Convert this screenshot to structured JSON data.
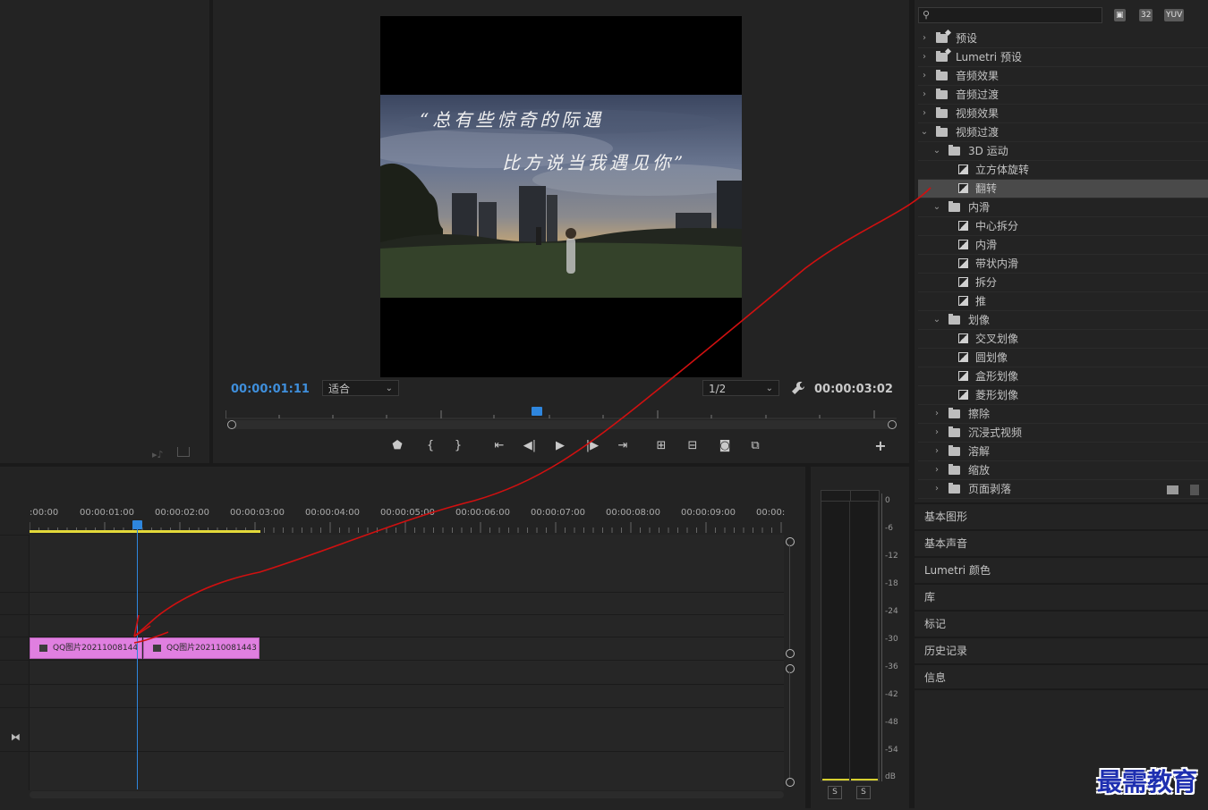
{
  "program_monitor": {
    "current_timecode": "00:00:01:11",
    "duration_timecode": "00:00:03:02",
    "zoom_value": "适合",
    "resolution_value": "1/2",
    "caption_line_1": "“总有些惊奇的际遇",
    "caption_line_2": "比方说当我遇见你”",
    "playhead_fraction": 0.46
  },
  "effects_panel": {
    "search_value": "",
    "badges": [
      "32",
      "YUV"
    ],
    "tree": [
      {
        "label": "预设",
        "type": "preset-folder",
        "level": 0,
        "expanded": false
      },
      {
        "label": "Lumetri 预设",
        "type": "preset-folder",
        "level": 0,
        "expanded": false
      },
      {
        "label": "音频效果",
        "type": "folder",
        "level": 0,
        "expanded": false
      },
      {
        "label": "音频过渡",
        "type": "folder",
        "level": 0,
        "expanded": false
      },
      {
        "label": "视频效果",
        "type": "folder",
        "level": 0,
        "expanded": false
      },
      {
        "label": "视频过渡",
        "type": "folder",
        "level": 0,
        "expanded": true
      },
      {
        "label": "3D 运动",
        "type": "folder",
        "level": 1,
        "expanded": true
      },
      {
        "label": "立方体旋转",
        "type": "effect",
        "level": 2
      },
      {
        "label": "翻转",
        "type": "effect",
        "level": 2,
        "selected": true
      },
      {
        "label": "内滑",
        "type": "folder",
        "level": 1,
        "expanded": true
      },
      {
        "label": "中心拆分",
        "type": "effect",
        "level": 2
      },
      {
        "label": "内滑",
        "type": "effect",
        "level": 2
      },
      {
        "label": "带状内滑",
        "type": "effect",
        "level": 2
      },
      {
        "label": "拆分",
        "type": "effect",
        "level": 2
      },
      {
        "label": "推",
        "type": "effect",
        "level": 2
      },
      {
        "label": "划像",
        "type": "folder",
        "level": 1,
        "expanded": true
      },
      {
        "label": "交叉划像",
        "type": "effect",
        "level": 2
      },
      {
        "label": "圆划像",
        "type": "effect",
        "level": 2
      },
      {
        "label": "盒形划像",
        "type": "effect",
        "level": 2
      },
      {
        "label": "菱形划像",
        "type": "effect",
        "level": 2
      },
      {
        "label": "擦除",
        "type": "folder",
        "level": 1,
        "expanded": false
      },
      {
        "label": "沉浸式视频",
        "type": "folder",
        "level": 1,
        "expanded": false
      },
      {
        "label": "溶解",
        "type": "folder",
        "level": 1,
        "expanded": false
      },
      {
        "label": "缩放",
        "type": "folder",
        "level": 1,
        "expanded": false
      },
      {
        "label": "页面剥落",
        "type": "folder",
        "level": 1,
        "expanded": false
      }
    ]
  },
  "side_panels": [
    "基本图形",
    "基本声音",
    "Lumetri 颜色",
    "库",
    "标记",
    "历史记录",
    "信息"
  ],
  "timeline": {
    "ruler_labels": [
      ":00:00",
      "00:00:01:00",
      "00:00:02:00",
      "00:00:03:00",
      "00:00:04:00",
      "00:00:05:00",
      "00:00:06:00",
      "00:00:07:00",
      "00:00:08:00",
      "00:00:09:00",
      "00:00:"
    ],
    "clips": [
      "QQ图片20211008144",
      "QQ图片202110081443"
    ]
  },
  "audio_meter": {
    "db_labels": [
      "0",
      "-6",
      "-12",
      "-18",
      "-24",
      "-30",
      "-36",
      "-42",
      "-48",
      "-54",
      "dB"
    ],
    "solo_labels": [
      "S",
      "S"
    ]
  },
  "watermark": "最需教育",
  "colors": {
    "accent_blue": "#2e86de",
    "clip_pink": "#e07fe0",
    "work_area_yellow": "#e3d93a",
    "annotation_red": "#d01010"
  }
}
